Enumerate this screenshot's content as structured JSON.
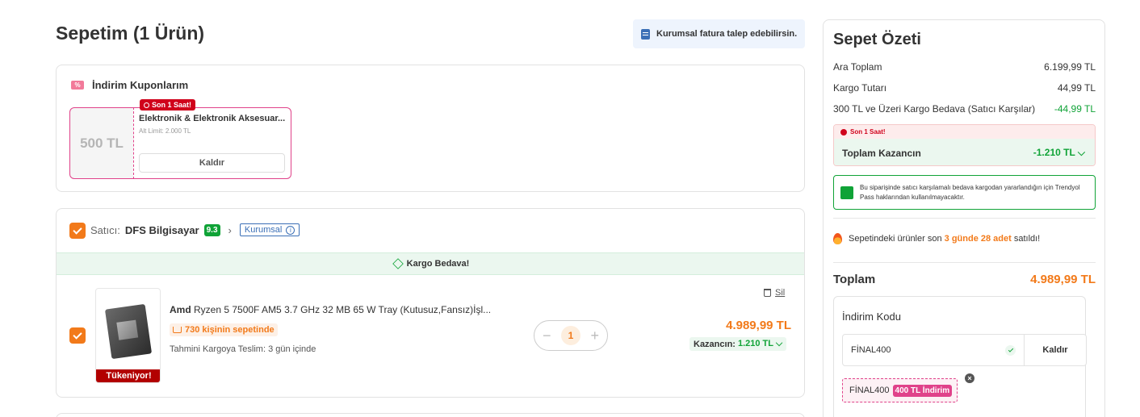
{
  "header": {
    "title": "Sepetim (1 Ürün)",
    "corporate_invoice": "Kurumsal fatura talep edebilirsin."
  },
  "coupons": {
    "heading": "İndirim Kuponlarım",
    "icon": "ticket-icon",
    "items": [
      {
        "amount": "500 TL",
        "badge": "Son 1 Saat!",
        "title": "Elektronik & Elektronik Aksesuar...",
        "limit": "Alt Limit: 2.000 TL",
        "action": "Kaldır"
      }
    ]
  },
  "seller": {
    "label": "Satıcı:",
    "name": "DFS Bilgisayar",
    "score": "9.3",
    "chevron": "›",
    "type_badge": "Kurumsal",
    "info": "i",
    "shipping_banner": "Kargo Bedava!"
  },
  "product": {
    "brand": "Amd",
    "name": " Ryzen 5 7500F AM5 3.7 GHz 32 MB 65 W Tray (Kutusuz,Fansız)İşl...",
    "basket_count": "730 kişinin sepetinde",
    "delivery": "Tahmini Kargoya Teslim:  3 gün içinde",
    "stock_badge": "Tükeniyor!",
    "quantity": "1",
    "minus": "−",
    "plus": "+",
    "delete_label": "Sil",
    "price": "4.989,99 TL",
    "savings_label": "Kazancın:",
    "savings_value": "1.210 TL ⌵"
  },
  "summary": {
    "title": "Sepet Özeti",
    "rows": [
      {
        "label": "Ara Toplam",
        "value": "6.199,99 TL"
      },
      {
        "label": "Kargo Tutarı",
        "value": "44,99 TL"
      },
      {
        "label": "300 TL ve Üzeri Kargo Bedava (Satıcı Karşılar)",
        "value": "-44,99 TL"
      }
    ],
    "earn_badge": "Son 1 Saat!",
    "earn_label": "Toplam Kazancın",
    "earn_value": "-1.210 TL ⌵",
    "pass_note": "Bu siparişinde satıcı karşılamalı bedava kargodan yararlandığın için Trendyol Pass haklarından kullanılmayacaktır.",
    "sold_prefix": "Sepetindeki ürünler son ",
    "sold_highlight": "3 günde 28 adet",
    "sold_suffix": " satıldı!",
    "total_label": "Toplam",
    "total_value": "4.989,99 TL",
    "discount_code": {
      "label": "İndirim Kodu",
      "value": "FİNAL400",
      "remove": "Kaldır",
      "applied_code": "FİNAL400",
      "applied_discount": "400 TL İndirim",
      "close": "×"
    }
  },
  "colors": {
    "accent": "#f27a1a",
    "success": "#10a337",
    "pink": "#e0428a",
    "danger": "#d0021b"
  }
}
